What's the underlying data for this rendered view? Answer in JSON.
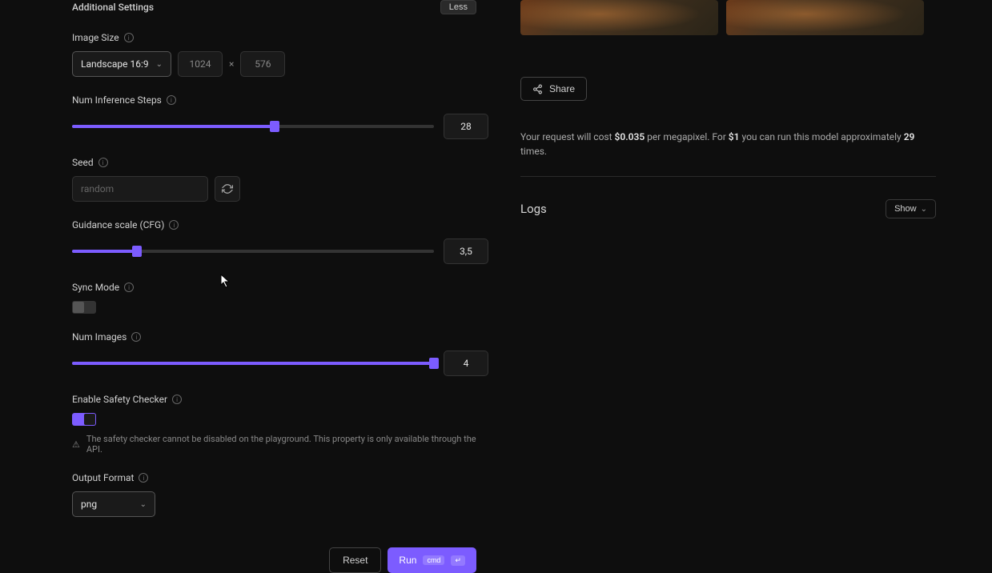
{
  "header": {
    "title": "Additional Settings",
    "less": "Less"
  },
  "imageSize": {
    "label": "Image Size",
    "preset": "Landscape 16:9",
    "width": "1024",
    "height": "576"
  },
  "steps": {
    "label": "Num Inference Steps",
    "value": "28",
    "percent": 56
  },
  "seed": {
    "label": "Seed",
    "placeholder": "random"
  },
  "guidance": {
    "label": "Guidance scale (CFG)",
    "value": "3,5",
    "percent": 18
  },
  "syncMode": {
    "label": "Sync Mode"
  },
  "numImages": {
    "label": "Num Images",
    "value": "4",
    "percent": 100
  },
  "safety": {
    "label": "Enable Safety Checker",
    "warning": "The safety checker cannot be disabled on the playground. This property is only available through the API."
  },
  "outputFormat": {
    "label": "Output Format",
    "value": "png"
  },
  "buttons": {
    "reset": "Reset",
    "run": "Run",
    "cmd": "cmd",
    "enter": "↵"
  },
  "share": {
    "label": "Share"
  },
  "cost": {
    "prefix": "Your request will cost ",
    "price": "$0.035",
    "mid": " per megapixel. For ",
    "dollar": "$1",
    "mid2": " you can run this model approximately ",
    "times": "29",
    "suffix": " times."
  },
  "logs": {
    "title": "Logs",
    "show": "Show"
  }
}
